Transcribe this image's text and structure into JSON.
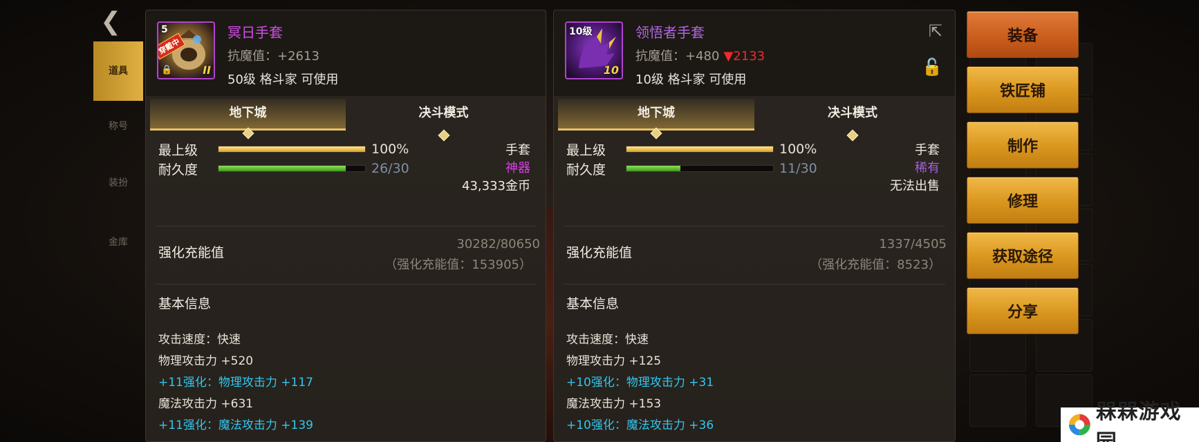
{
  "nav": {
    "tabs": [
      "道具",
      "称号",
      "装扮",
      "金库"
    ]
  },
  "left": {
    "icon_level": "5",
    "icon_badge": "穿戴中",
    "icon_num": "II",
    "name": "冥日手套",
    "stat_label": "抗魔值：",
    "stat_value": "+2613",
    "requirement": "50级 格斗家 可使用",
    "mode_tabs": [
      "地下城",
      "决斗模式"
    ],
    "max_level_label": "最上级",
    "max_level_value": "100%",
    "max_level_percent": 100,
    "durability_label": "耐久度",
    "durability_value": "26/30",
    "durability_percent": 86.7,
    "type": "手套",
    "rarity": "神器",
    "price": "43,333金币",
    "enhance_title": "强化充能值",
    "enhance_progress": "30282/80650",
    "enhance_total": "（强化充能值：153905）",
    "basic_info_title": "基本信息",
    "lines": [
      {
        "text": "攻击速度：快速",
        "style": "normal"
      },
      {
        "text": "物理攻击力 +520",
        "style": "normal"
      },
      {
        "text": "+11强化：物理攻击力 +117",
        "style": "cyan"
      },
      {
        "text": "魔法攻击力 +631",
        "style": "normal"
      },
      {
        "text": "+11强化：魔法攻击力 +139",
        "style": "cyan"
      }
    ]
  },
  "right": {
    "icon_level": "10级",
    "icon_num": "10",
    "name": "领悟者手套",
    "stat_label": "抗魔值：",
    "stat_value": "+480",
    "stat_diff": "▼2133",
    "requirement": "10级 格斗家 可使用",
    "mode_tabs": [
      "地下城",
      "决斗模式"
    ],
    "max_level_label": "最上级",
    "max_level_value": "100%",
    "max_level_percent": 100,
    "durability_label": "耐久度",
    "durability_value": "11/30",
    "durability_percent": 36.7,
    "type": "手套",
    "rarity": "稀有",
    "price": "无法出售",
    "enhance_title": "强化充能值",
    "enhance_progress": "1337/4505",
    "enhance_total": "（强化充能值：8523）",
    "basic_info_title": "基本信息",
    "lines": [
      {
        "text": "攻击速度：快速",
        "style": "normal"
      },
      {
        "text": "物理攻击力 +125",
        "style": "normal"
      },
      {
        "text": "+10强化：物理攻击力 +31",
        "style": "cyan"
      },
      {
        "text": "魔法攻击力 +153",
        "style": "normal"
      },
      {
        "text": "+10强化：魔法攻击力 +36",
        "style": "cyan"
      }
    ]
  },
  "actions": [
    "装备",
    "铁匠铺",
    "制作",
    "修理",
    "获取途径",
    "分享"
  ],
  "watermark": "槑槑游戏园",
  "colors": {
    "artifact": "#d840e8",
    "rare": "#a45ee0",
    "enhance": "#32c6ee",
    "stat_down": "#ee2a2a",
    "button": "#d9961e",
    "button_primary": "#c85c1c"
  }
}
